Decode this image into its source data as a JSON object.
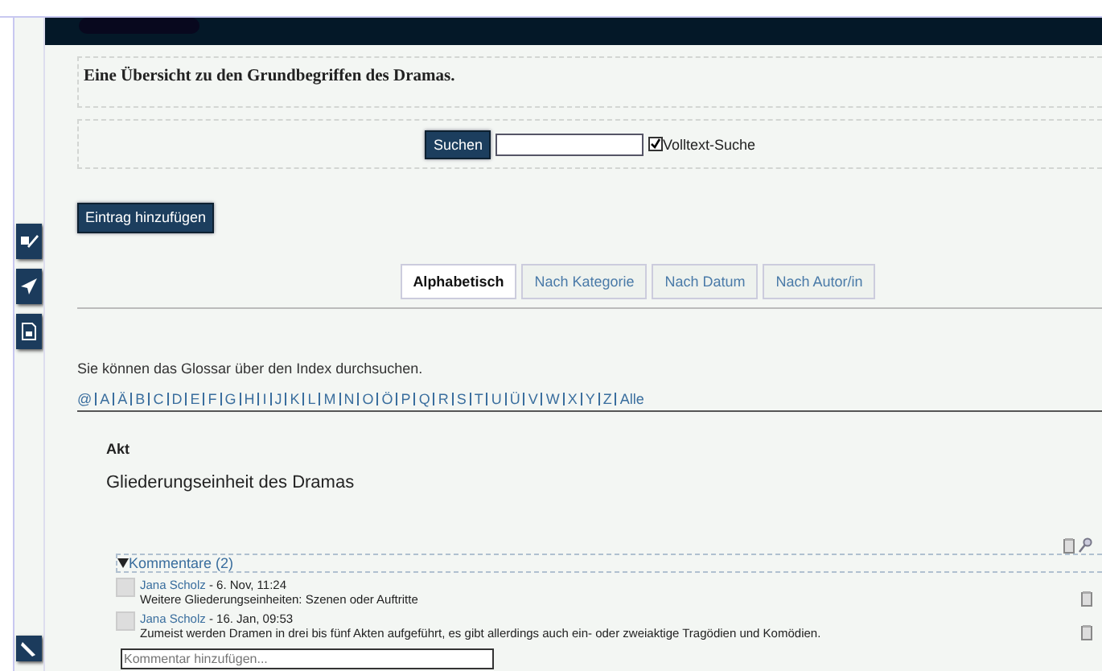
{
  "description": "Eine Übersicht zu den Grundbegriffen des Dramas.",
  "search": {
    "button": "Suchen",
    "fulltext": {
      "label": "Volltext-Suche",
      "checked": true
    }
  },
  "add_entry": "Eintrag hinzufügen",
  "tabs": [
    {
      "label": "Alphabetisch",
      "selected": true
    },
    {
      "label": "Nach Kategorie",
      "selected": false
    },
    {
      "label": "Nach Datum",
      "selected": false
    },
    {
      "label": "Nach Autor/in",
      "selected": false
    }
  ],
  "hint": "Sie können das Glossar über den Index durchsuchen.",
  "index": [
    "@",
    "A",
    "Ä",
    "B",
    "C",
    "D",
    "E",
    "F",
    "G",
    "H",
    "I",
    "J",
    "K",
    "L",
    "M",
    "N",
    "O",
    "Ö",
    "P",
    "Q",
    "R",
    "S",
    "T",
    "U",
    "Ü",
    "V",
    "W",
    "X",
    "Y",
    "Z",
    "Alle"
  ],
  "entry": {
    "term": "Akt",
    "definition": "Gliederungseinheit des Dramas",
    "comments": {
      "toggle": "Kommentare (2)",
      "expanded": true,
      "items": [
        {
          "author": "Jana Scholz",
          "date": " - 6. Nov, 11:24",
          "text": "Weitere Gliederungseinheiten: Szenen oder Auftritte"
        },
        {
          "author": "Jana Scholz",
          "date": " - 16. Jan, 09:53",
          "text": "Zumeist werden Dramen in drei bis fünf Akten aufgeführt, es gibt allerdings auch ein- oder zweiaktige Tragödien und Komödien."
        }
      ],
      "placeholder": "Kommentar hinzufügen..."
    }
  }
}
